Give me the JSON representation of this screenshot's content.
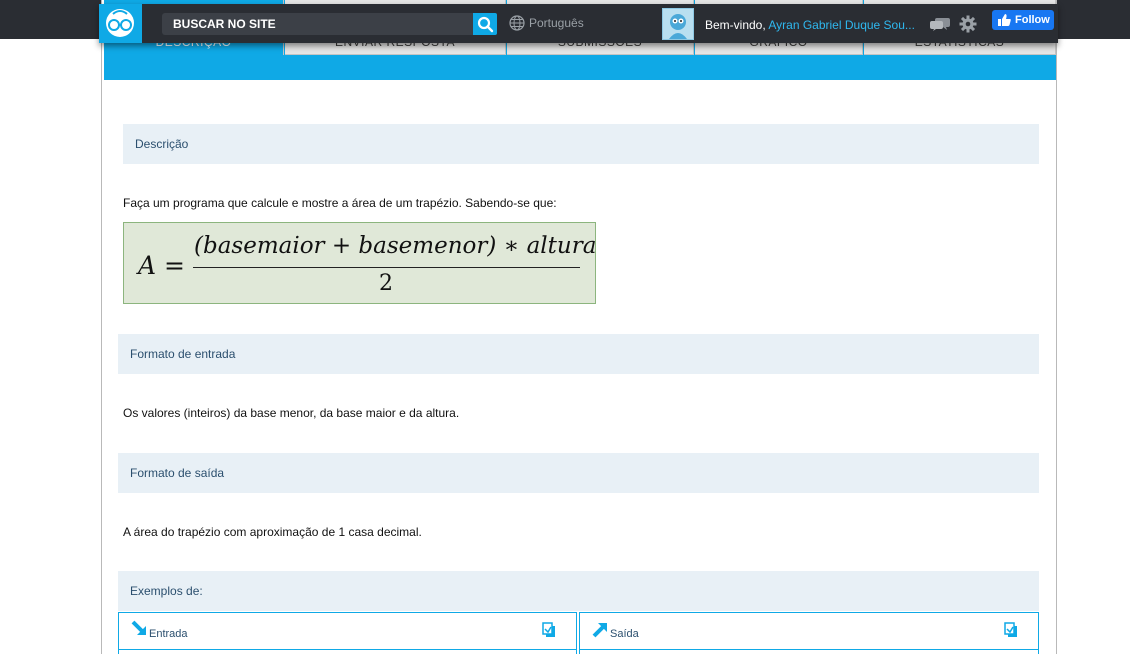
{
  "header": {
    "search_placeholder": "BUSCAR NO SITE",
    "language": "Português",
    "welcome_prefix": "Bem-vindo,",
    "user_name": "Ayran Gabriel Duque Sou...",
    "follow_label": "Follow"
  },
  "tabs": [
    {
      "label": "DESCRIÇÃO"
    },
    {
      "label": "ENVIAR RESPOSTA"
    },
    {
      "label": "SUBMISSÕES"
    },
    {
      "label": "GRÁFICO"
    },
    {
      "label": "ESTATÍSTICAS"
    }
  ],
  "problem": {
    "description_title": "Descrição",
    "description_text": "Faça um programa que calcule e mostre a área de um trapézio. Sabendo-se que:",
    "formula": {
      "lhs": "A",
      "equals": "=",
      "numerator": "(basemaior + basemenor) ∗ altura",
      "denominator": "2"
    },
    "input_title": "Formato de entrada",
    "input_text": "Os valores (inteiros) da base menor, da base maior e da altura.",
    "output_title": "Formato de saída",
    "output_text": "A área do trapézio com aproximação de 1 casa decimal.",
    "examples_title": "Exemplos de:",
    "example_input_label": "Entrada",
    "example_output_label": "Saída"
  },
  "colors": {
    "accent": "#0fa9e6",
    "nav_bg": "#2a2d33",
    "section_bg": "#e8f0f6",
    "formula_bg": "#e0e8d8"
  }
}
